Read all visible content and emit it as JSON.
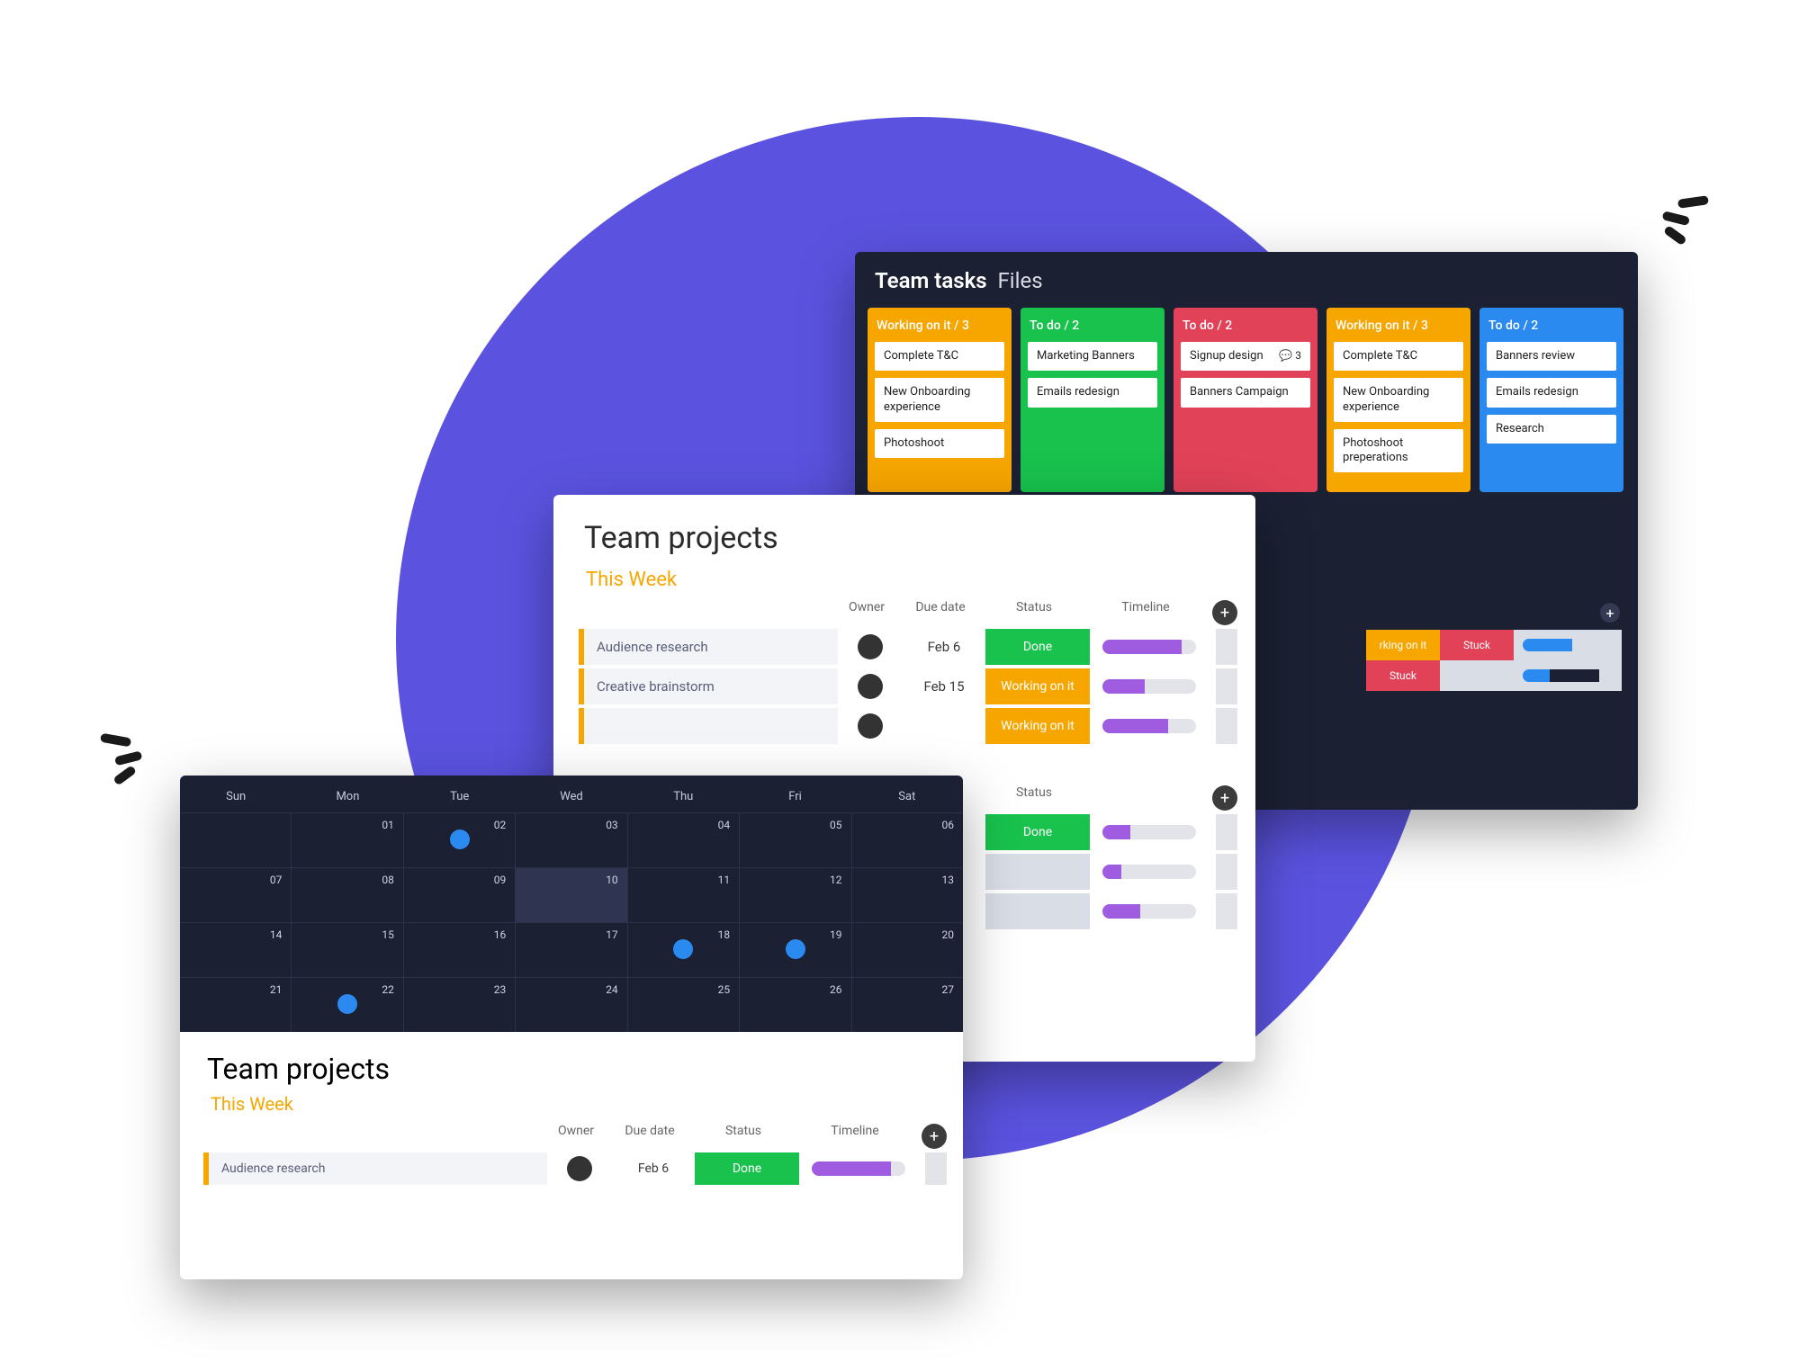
{
  "colors": {
    "accent_purple": "#5b53e0",
    "orange": "#f7a600",
    "green": "#18c24d",
    "red": "#e14258",
    "blue": "#2b8aef",
    "purple_bar": "#a05ce0",
    "dark_panel": "#1b2033"
  },
  "kanban": {
    "title_bold": "Team tasks",
    "title_tab": "Files",
    "columns": [
      {
        "color": "orange",
        "title": "Working on it / 3",
        "cards": [
          "Complete T&C",
          "New Onboarding experience",
          "Photoshoot"
        ]
      },
      {
        "color": "green",
        "title": "To do / 2",
        "cards": [
          "Marketing Banners",
          "Emails redesign"
        ]
      },
      {
        "color": "red",
        "title": "To do / 2",
        "cards": [
          "Signup design",
          "Banners Campaign"
        ],
        "card_meta": [
          "💬 3",
          ""
        ]
      },
      {
        "color": "orange",
        "title": "Working on it / 3",
        "cards": [
          "Complete T&C",
          "New Onboarding experience",
          "Photoshoot preperations"
        ]
      },
      {
        "color": "blue",
        "title": "To do / 2",
        "cards": [
          "Banners review",
          "Emails redesign",
          "Research"
        ]
      }
    ],
    "summary": {
      "rows": [
        {
          "cells": [
            "rking on it",
            "Stuck"
          ],
          "bar_a": 55,
          "bar_b": 0
        },
        {
          "cells": [
            "Stuck",
            ""
          ],
          "bar_a": 30,
          "bar_b": 55
        }
      ]
    }
  },
  "mid": {
    "title": "Team projects",
    "group1": {
      "name": "This Week",
      "headers": {
        "owner": "Owner",
        "due": "Due date",
        "status": "Status",
        "timeline": "Timeline"
      },
      "rows": [
        {
          "task": "Audience research",
          "date": "Feb 6",
          "status": "Done",
          "status_class": "s-done",
          "tl": 85
        },
        {
          "task": "Creative brainstorm",
          "date": "Feb 15",
          "status": "Working on it",
          "status_class": "s-work",
          "tl": 45
        },
        {
          "task": "",
          "date": "",
          "status": "Working on it",
          "status_class": "s-work",
          "tl": 70
        }
      ]
    },
    "group2": {
      "headers": {
        "status": "Status"
      },
      "rows": [
        {
          "status": "Done",
          "status_class": "s-done",
          "tl": 30
        },
        {
          "status": "",
          "status_class": "s-empty",
          "tl": 20
        },
        {
          "status": "",
          "status_class": "s-empty",
          "tl": 40
        }
      ]
    }
  },
  "front": {
    "calendar": {
      "day_names": [
        "Sun",
        "Mon",
        "Tue",
        "Wed",
        "Thu",
        "Fri",
        "Sat"
      ],
      "weeks": [
        [
          "",
          "01",
          "02",
          "03",
          "04",
          "05",
          "06"
        ],
        [
          "07",
          "08",
          "09",
          "10",
          "11",
          "12",
          "13"
        ],
        [
          "14",
          "15",
          "16",
          "17",
          "18",
          "19",
          "20"
        ],
        [
          "21",
          "22",
          "23",
          "24",
          "25",
          "26",
          "27"
        ]
      ],
      "dots": [
        [
          0,
          2
        ],
        [
          2,
          4
        ],
        [
          2,
          5
        ],
        [
          3,
          1
        ]
      ],
      "selected": [
        1,
        3
      ]
    },
    "title": "Team projects",
    "group": {
      "name": "This Week",
      "headers": {
        "owner": "Owner",
        "due": "Due date",
        "status": "Status",
        "timeline": "Timeline"
      },
      "rows": [
        {
          "task": "Audience research",
          "date": "Feb 6",
          "status": "Done",
          "status_class": "s-done",
          "tl": 85
        }
      ]
    }
  }
}
